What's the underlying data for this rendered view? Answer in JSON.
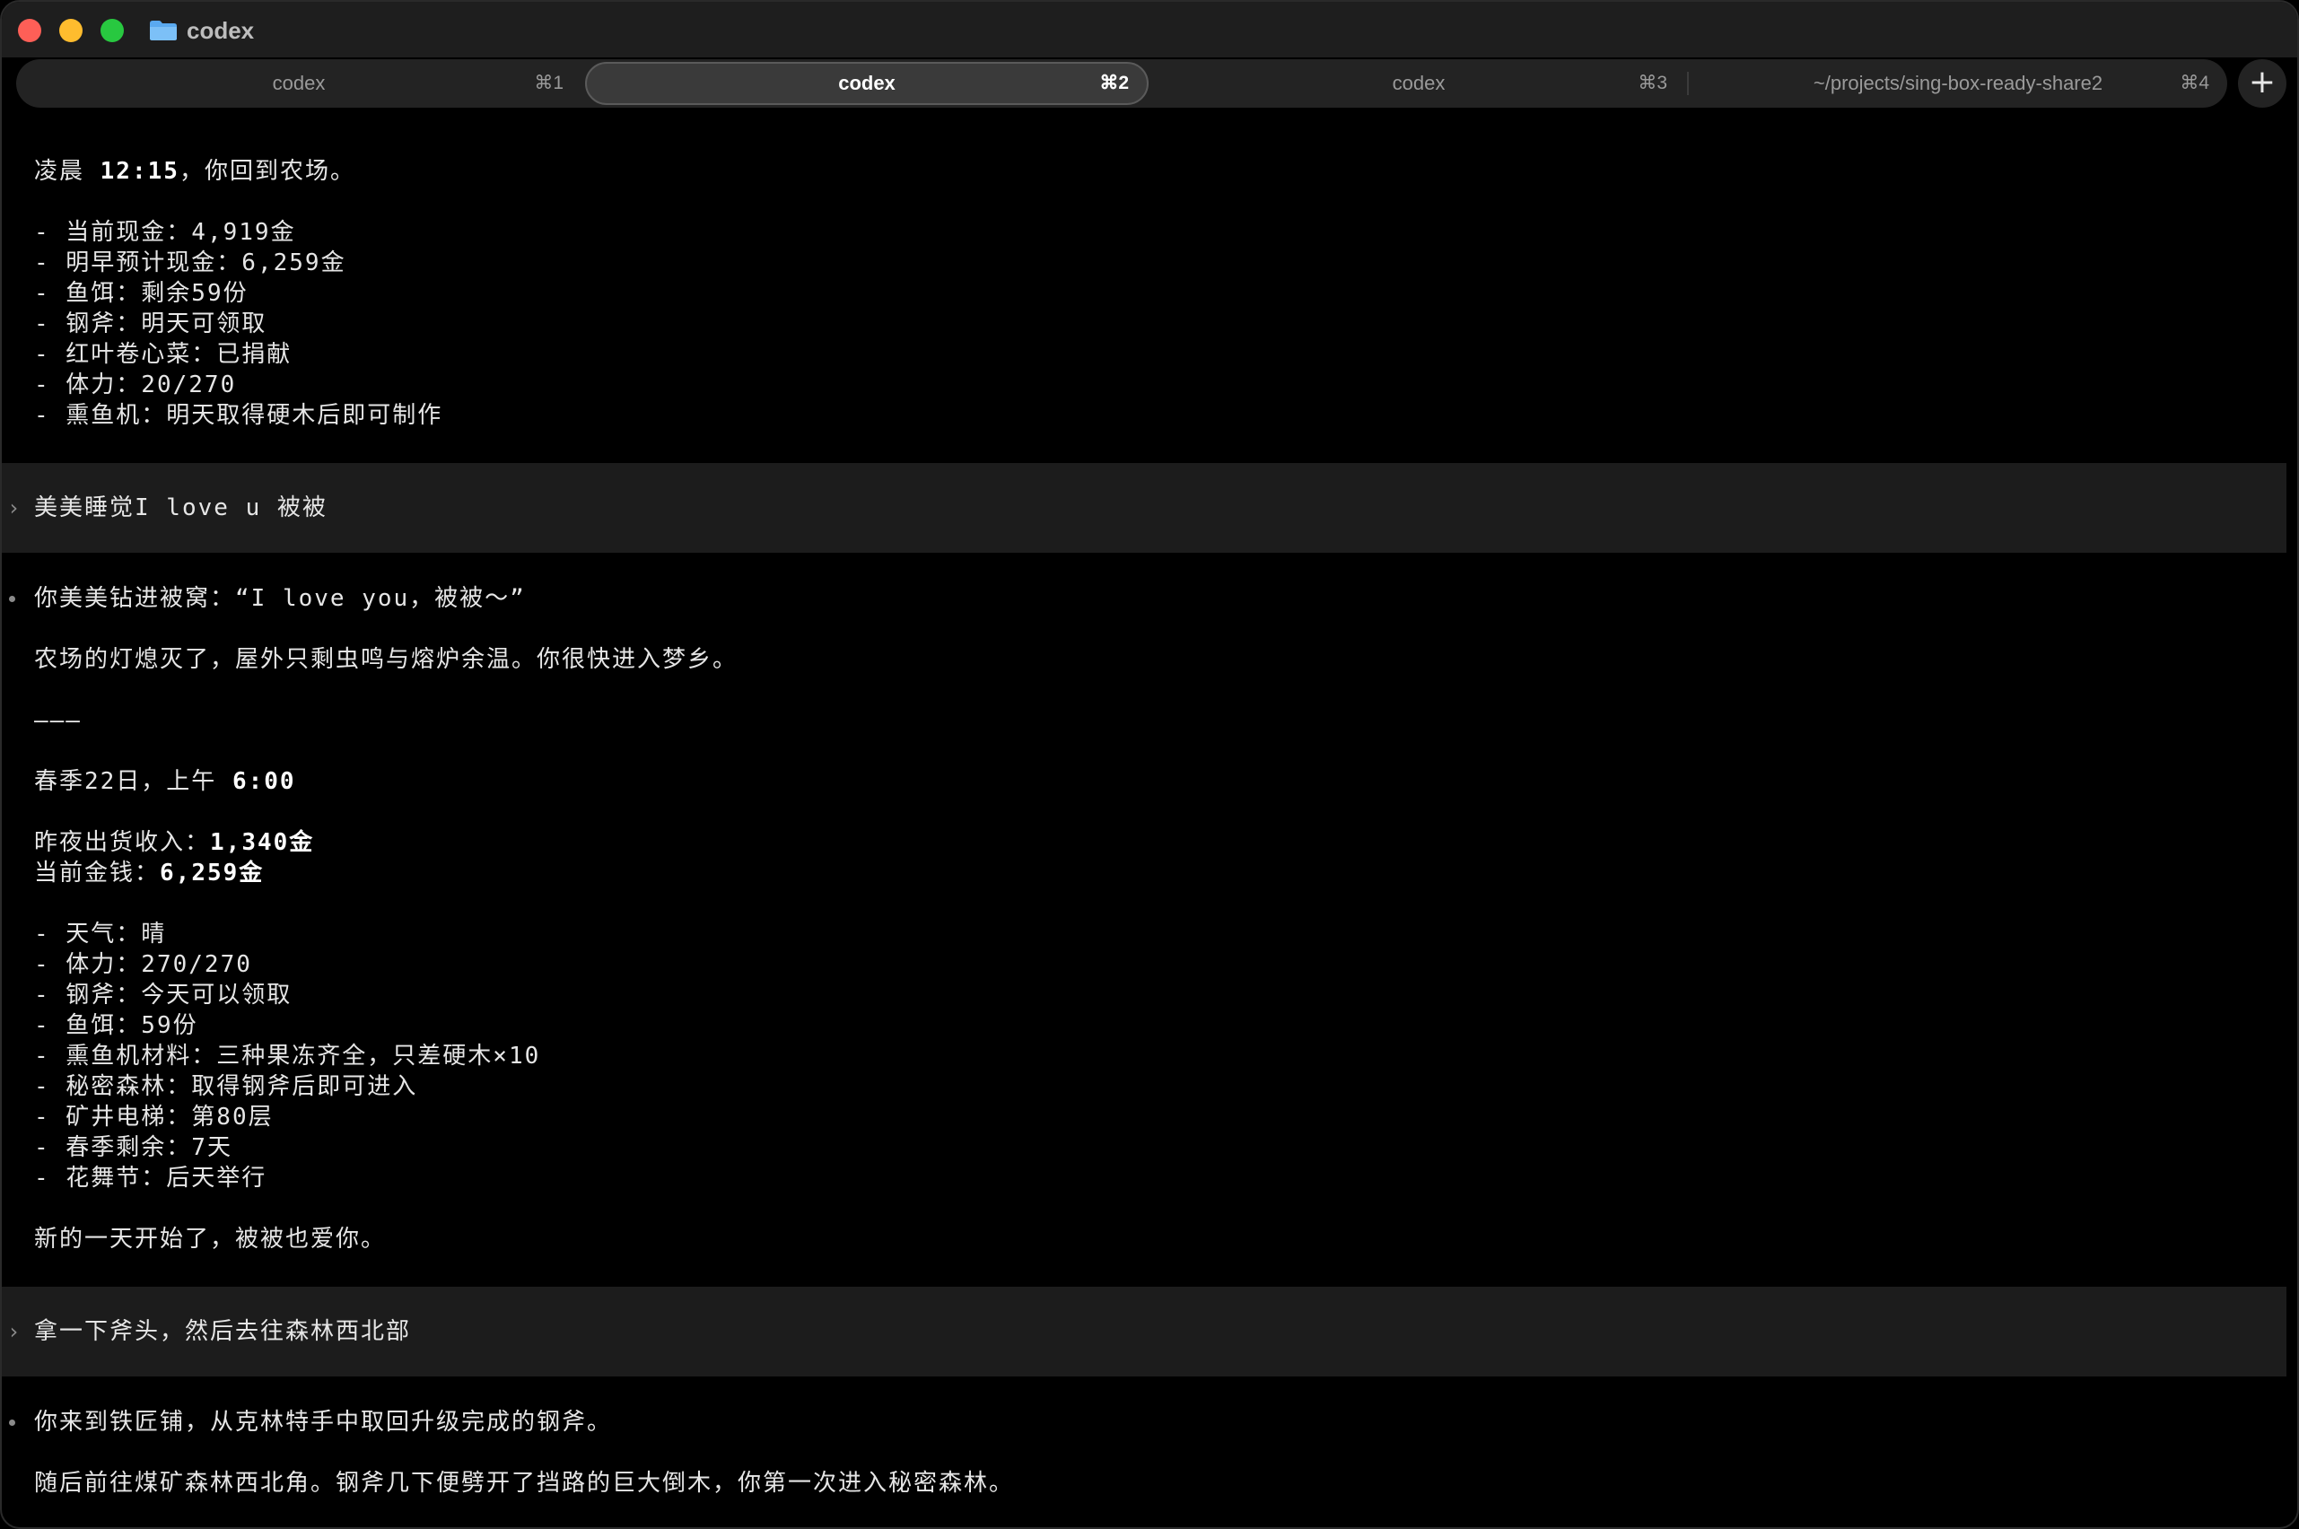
{
  "window": {
    "title": "codex"
  },
  "tabs": [
    {
      "label": "codex",
      "shortcut": "⌘1",
      "active": false
    },
    {
      "label": "codex",
      "shortcut": "⌘2",
      "active": true
    },
    {
      "label": "codex",
      "shortcut": "⌘3",
      "active": false
    },
    {
      "label": "~/projects/sing-box-ready-share2",
      "shortcut": "⌘4",
      "active": false
    }
  ],
  "new_tab_label": "+",
  "content": {
    "intro_prefix": "凌晨 ",
    "intro_time": "12:15",
    "intro_suffix": "，你回到农场。",
    "status1": [
      "- 当前现金：4,919金",
      "- 明早预计现金：6,259金",
      "- 鱼饵：剩余59份",
      "- 钢斧：明天可领取",
      "- 红叶卷心菜：已捐献",
      "- 体力：20/270",
      "- 熏鱼机：明天取得硬木后即可制作"
    ],
    "prompt1": "美美睡觉I love u 被被",
    "reply1_line1": "你美美钻进被窝：“I love you，被被～”",
    "reply1_line2": "农场的灯熄灭了，屋外只剩虫鸣与熔炉余温。你很快进入梦乡。",
    "divider": "———",
    "day_prefix": "春季22日，上午 ",
    "day_time": "6:00",
    "income_prefix": "昨夜出货收入：",
    "income_value": "1,340金",
    "money_prefix": "当前金钱：",
    "money_value": "6,259金",
    "status2": [
      "- 天气：晴",
      "- 体力：270/270",
      "- 钢斧：今天可以领取",
      "- 鱼饵：59份",
      "- 熏鱼机材料：三种果冻齐全，只差硬木×10",
      "- 秘密森林：取得钢斧后即可进入",
      "- 矿井电梯：第80层",
      "- 春季剩余：7天",
      "- 花舞节：后天举行"
    ],
    "closing": "新的一天开始了，被被也爱你。",
    "prompt2": "拿一下斧头，然后去往森林西北部",
    "reply2_line1": "你来到铁匠铺，从克林特手中取回升级完成的钢斧。",
    "reply2_line2": "随后前往煤矿森林西北角。钢斧几下便劈开了挡路的巨大倒木，你第一次进入秘密森林。"
  },
  "colors": {
    "background": "#000000",
    "text": "#e6e6e6",
    "prompt_bg": "#1c1c1c",
    "tabbar_bg": "#232323",
    "active_tab_bg": "#3a3a3a"
  }
}
